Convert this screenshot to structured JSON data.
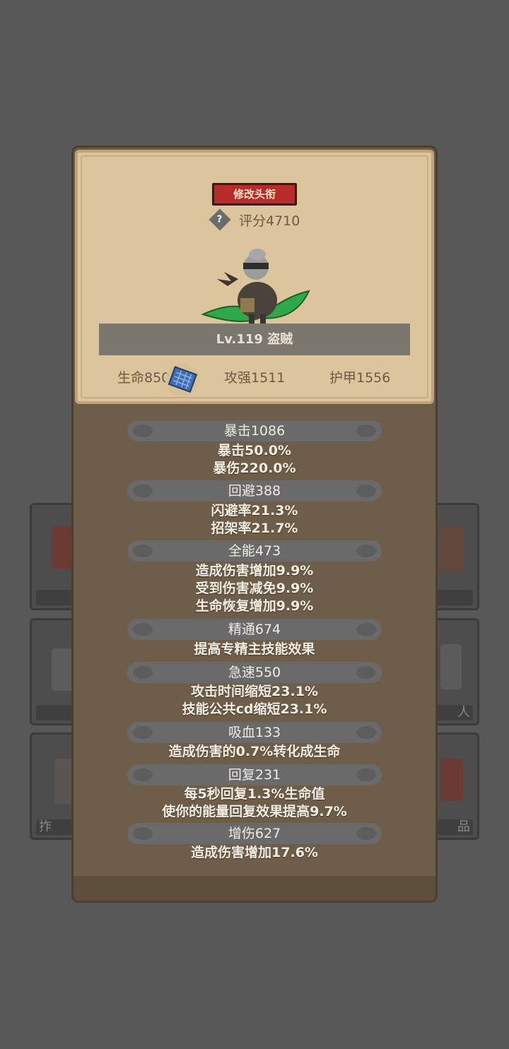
{
  "title_button": "修改头衔",
  "score": "评分4710",
  "level_label": "Lv.119 盗贼",
  "stats": {
    "hp": "生命850",
    "atk": "攻强1511",
    "armor": "护甲1556"
  },
  "sections": [
    {
      "header": "暴击1086",
      "lines": [
        "暴击50.0%",
        "暴伤220.0%"
      ]
    },
    {
      "header": "回避388",
      "lines": [
        "闪避率21.3%",
        "招架率21.7%"
      ]
    },
    {
      "header": "全能473",
      "lines": [
        "造成伤害增加9.9%",
        "受到伤害减免9.9%",
        "生命恢复增加9.9%"
      ]
    },
    {
      "header": "精通674",
      "lines": [
        "提高专精主技能效果"
      ]
    },
    {
      "header": "急速550",
      "lines": [
        "攻击时间缩短23.1%",
        "技能公共cd缩短23.1%"
      ]
    },
    {
      "header": "吸血133",
      "lines": [
        "造成伤害的0.7%转化成生命"
      ]
    },
    {
      "header": "回复231",
      "lines": [
        "每5秒回复1.3%生命值",
        "使你的能量回复效果提高9.7%"
      ]
    },
    {
      "header": "增伤627",
      "lines": [
        "造成伤害增加17.6%"
      ]
    }
  ],
  "background_labels": {
    "left_bottom": "拃",
    "right_middle": "人",
    "right_bottom": "品"
  },
  "icons": {
    "help": "question-diamond-icon",
    "scroll": "blue-scroll-icon"
  },
  "colors": {
    "title_button": "#b72b2b",
    "panel": "#6e5d48",
    "card": "#dcc49c"
  }
}
